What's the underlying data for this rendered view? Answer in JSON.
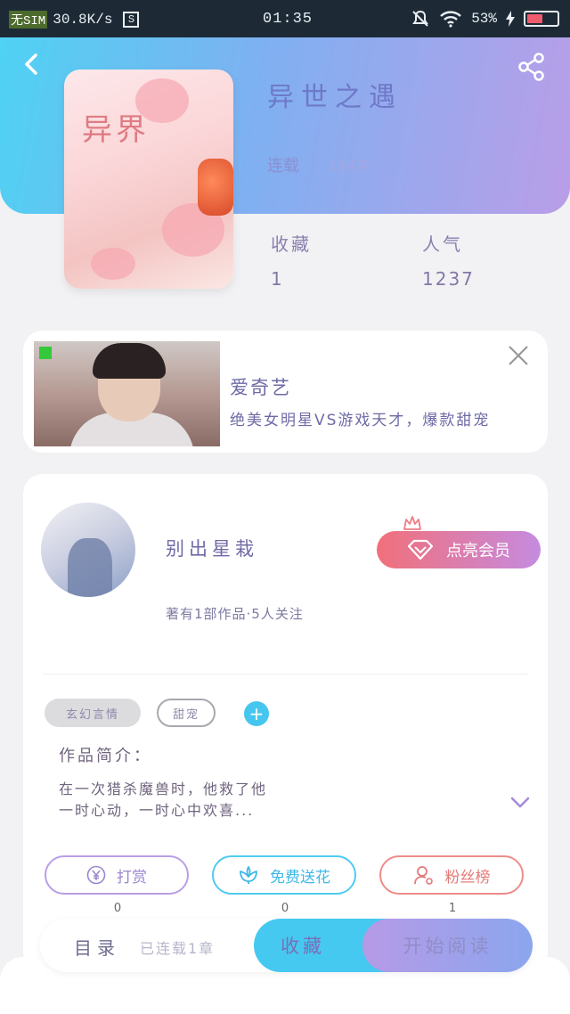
{
  "status_bar": {
    "carrier": "无SIM",
    "speed": "30.8K/s",
    "s_badge": "S",
    "time": "01:35",
    "battery_percent": "53%",
    "battery_level": 0.53,
    "colors": {
      "background": "#1d2a36",
      "battery": "#f05b6e"
    }
  },
  "header": {
    "back_icon": "chevron-left-icon",
    "share_icon": "share-icon",
    "gradient": [
      "#4fd2f3",
      "#b99ee8"
    ]
  },
  "book": {
    "cover_title": "异界",
    "title": "异世之遇",
    "status": "连载",
    "word_count": "184字",
    "stats": {
      "favorites_label": "收藏",
      "favorites_value": "1",
      "popularity_label": "人气",
      "popularity_value": "1237"
    }
  },
  "ad": {
    "brand": "爱奇艺",
    "text": "绝美女明星VS游戏天才，爆款甜宠",
    "close_icon": "close-icon"
  },
  "author": {
    "name": "别出星栽",
    "subtitle": "著有1部作品·5人关注",
    "vip_button": "点亮会员",
    "tags": [
      "玄幻言情",
      "甜宠"
    ],
    "add_tag": "+",
    "intro_label": "作品简介：",
    "intro_text_line1": "在一次猎杀魔兽时，他救了他",
    "intro_text_line2": "一时心动，一时心中欢喜..."
  },
  "actions": [
    {
      "label": "打赏",
      "icon": "yen-icon",
      "count": "0"
    },
    {
      "label": "免费送花",
      "icon": "flower-icon",
      "count": "0"
    },
    {
      "label": "粉丝榜",
      "icon": "user-icon",
      "count": "1"
    }
  ],
  "bottom_bar": {
    "toc": "目录",
    "updates": "已连载1章",
    "favorite": "收藏",
    "start_reading": "开始阅读",
    "colors": {
      "favorite": "#45c9f1",
      "read": "#b69ae6"
    }
  }
}
